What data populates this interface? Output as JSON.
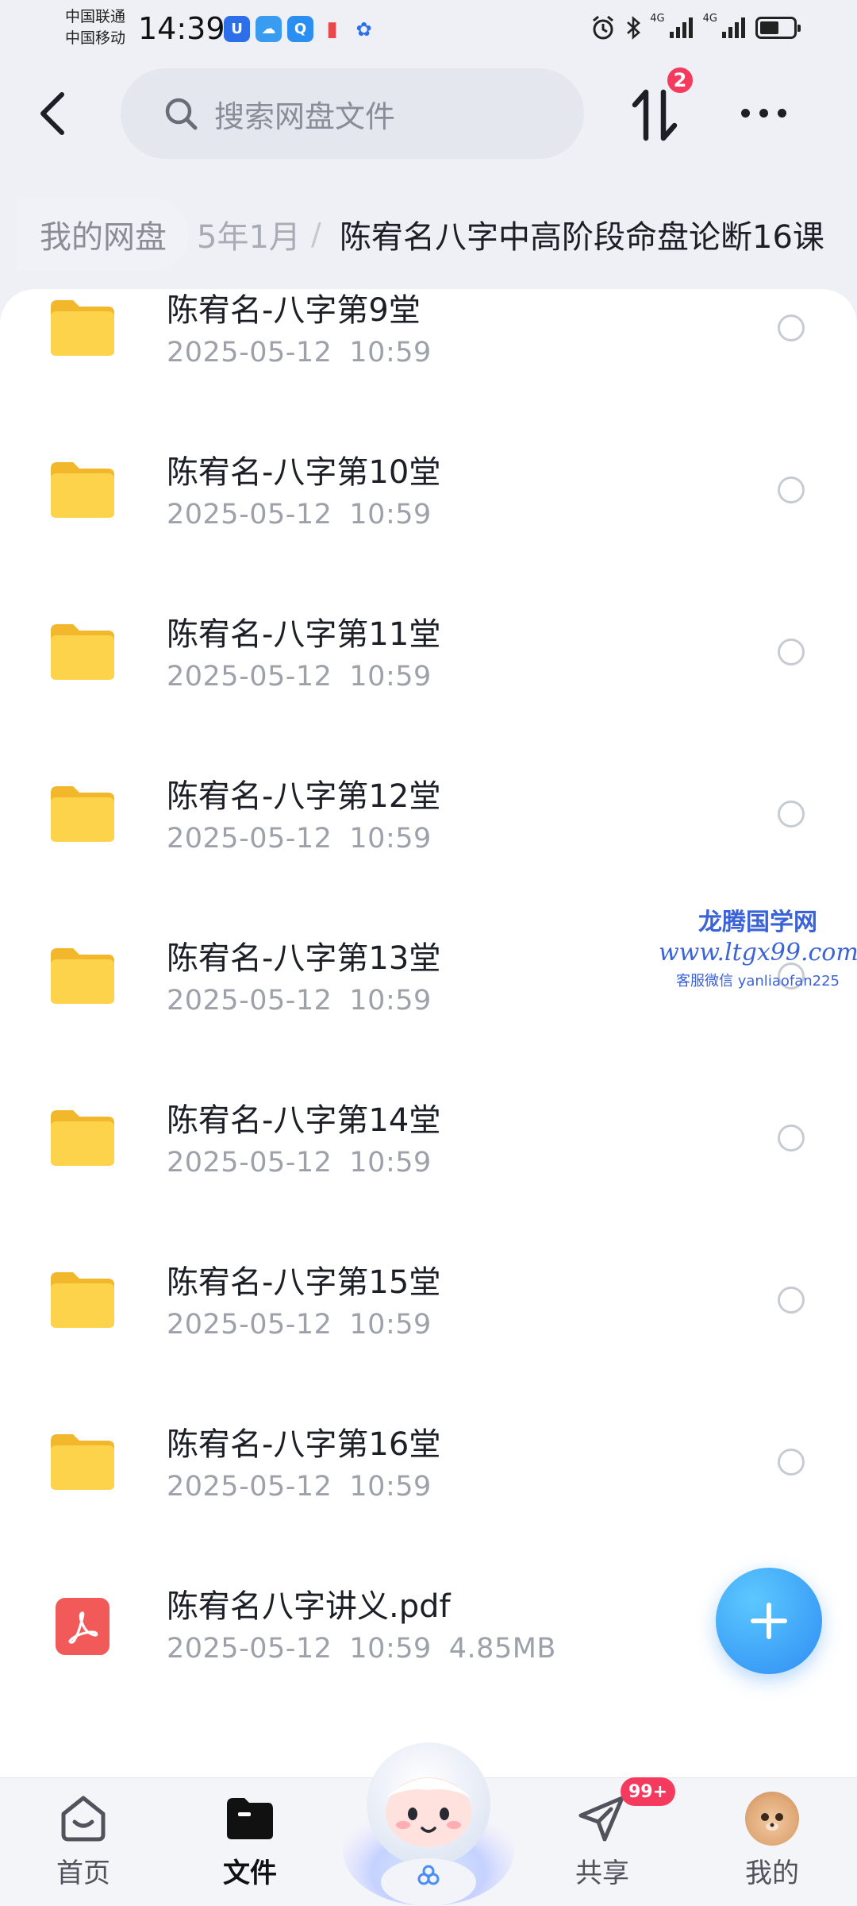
{
  "status_bar": {
    "carrier_1": "中国联通",
    "carrier_2": "中国移动",
    "time": "14:39",
    "signal_1": "4G",
    "signal_2": "4G",
    "battery_percent": 58
  },
  "top_bar": {
    "search_placeholder": "搜索网盘文件",
    "transfer_badge": "2"
  },
  "breadcrumb": {
    "root": "我的网盘",
    "middle": "5年1月",
    "separator": "/",
    "current": "陈宥名八字中高阶段命盘论断16课"
  },
  "files": [
    {
      "name": "陈宥名-八字第9堂",
      "date": "2025-05-12",
      "time": "10:59",
      "type": "folder"
    },
    {
      "name": "陈宥名-八字第10堂",
      "date": "2025-05-12",
      "time": "10:59",
      "type": "folder"
    },
    {
      "name": "陈宥名-八字第11堂",
      "date": "2025-05-12",
      "time": "10:59",
      "type": "folder"
    },
    {
      "name": "陈宥名-八字第12堂",
      "date": "2025-05-12",
      "time": "10:59",
      "type": "folder"
    },
    {
      "name": "陈宥名-八字第13堂",
      "date": "2025-05-12",
      "time": "10:59",
      "type": "folder"
    },
    {
      "name": "陈宥名-八字第14堂",
      "date": "2025-05-12",
      "time": "10:59",
      "type": "folder"
    },
    {
      "name": "陈宥名-八字第15堂",
      "date": "2025-05-12",
      "time": "10:59",
      "type": "folder"
    },
    {
      "name": "陈宥名-八字第16堂",
      "date": "2025-05-12",
      "time": "10:59",
      "type": "folder"
    },
    {
      "name": "陈宥名八字讲义.pdf",
      "date": "2025-05-12",
      "time": "10:59",
      "size": "4.85MB",
      "type": "pdf"
    }
  ],
  "watermark": {
    "line1": "龙腾国学网",
    "line2": "www.ltgx99.com",
    "line3": "客服微信 yanliaofan225"
  },
  "bottom_nav": {
    "home": "首页",
    "files": "文件",
    "share": "共享",
    "share_badge": "99+",
    "mine": "我的"
  },
  "colors": {
    "accent_blue": "#2f8df3",
    "badge_red": "#f43b5d",
    "folder_yellow": "#f9c93a",
    "pdf_red": "#f25a5a"
  }
}
